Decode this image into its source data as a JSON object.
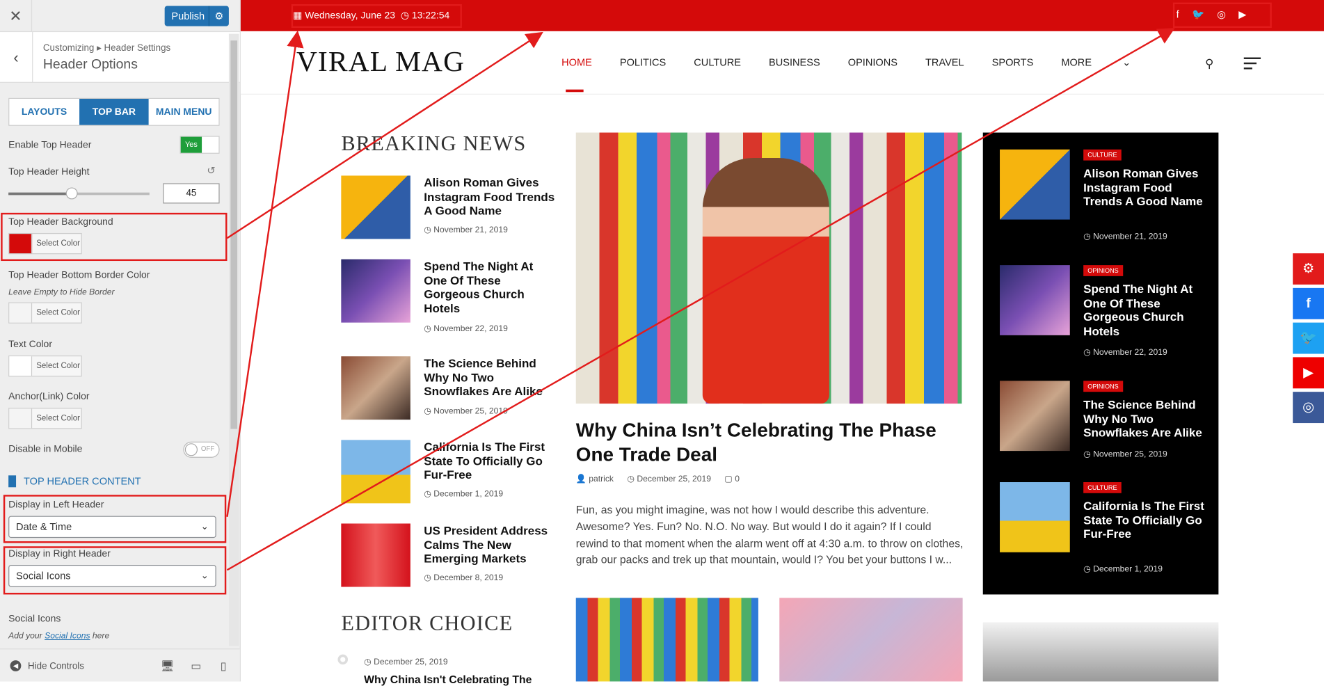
{
  "customizer": {
    "close": "✕",
    "publish": "Publish",
    "breadcrumb": "Customizing ▸ Header Settings",
    "title": "Header Options",
    "tabs": [
      "LAYOUTS",
      "TOP BAR",
      "MAIN MENU"
    ],
    "enable_top_header": "Enable Top Header",
    "toggle_yes": "Yes",
    "top_header_height": "Top Header Height",
    "height_value": "45",
    "height_fraction": 0.45,
    "bg_label": "Top Header Background",
    "bg_color": "#d40a0a",
    "select_color": "Select Color",
    "border_label": "Top Header Bottom Border Color",
    "border_hint": "Leave Empty to Hide Border",
    "text_color": "Text Color",
    "link_color": "Anchor(Link) Color",
    "disable_mobile": "Disable in Mobile",
    "toggle_off": "OFF",
    "section": "TOP HEADER CONTENT",
    "left_label": "Display in Left Header",
    "left_value": "Date & Time",
    "right_label": "Display in Right Header",
    "right_value": "Social Icons",
    "social_label": "Social Icons",
    "social_hint_pre": "Add your ",
    "social_hint_link": "Social Icons",
    "social_hint_post": " here",
    "hide_controls": "Hide Controls"
  },
  "site": {
    "topbar": {
      "date": "Wednesday, June 23",
      "time": "13:22:54"
    },
    "logo": "VIRAL MAG",
    "nav": [
      "HOME",
      "POLITICS",
      "CULTURE",
      "BUSINESS",
      "OPINIONS",
      "TRAVEL",
      "SPORTS",
      "MORE"
    ],
    "breaking_title": "BREAKING NEWS",
    "breaking": [
      {
        "title": "Alison Roman Gives Instagram Food Trends A Good Name",
        "date": "November 21, 2019"
      },
      {
        "title": "Spend The Night At One Of These Gorgeous Church Hotels",
        "date": "November 22, 2019"
      },
      {
        "title": "The Science Behind Why No Two Snowflakes Are Alike",
        "date": "November 25, 2019"
      },
      {
        "title": "California Is The First State To Officially Go Fur-Free",
        "date": "December 1, 2019"
      },
      {
        "title": "US President Address Calms The New Emerging Markets",
        "date": "December 8, 2019"
      }
    ],
    "editor_title": "EDITOR CHOICE",
    "editor_date": "December 25, 2019",
    "editor_partial": "Why China Isn't Celebrating The",
    "hero": {
      "title": "Why China Isn’t Celebrating The Phase One Trade Deal",
      "author": "patrick",
      "date": "December 25, 2019",
      "comments": "0",
      "excerpt": "Fun, as you might imagine, was not how I would describe this adventure. Awesome? Yes. Fun? No. N.O. No way. But would I do it again? If I could rewind to that moment when the alarm went off at 4:30 a.m. to throw on clothes, grab our packs and trek up that mountain, would I? You bet your buttons I w..."
    },
    "dark": [
      {
        "cat": "CULTURE",
        "title": "Alison Roman Gives Instagram Food Trends A Good Name",
        "date": "November 21, 2019"
      },
      {
        "cat": "OPINIONS",
        "title": "Spend The Night At One Of These Gorgeous Church Hotels",
        "date": "November 22, 2019"
      },
      {
        "cat": "OPINIONS",
        "title": "The Science Behind Why No Two Snowflakes Are Alike",
        "date": "November 25, 2019"
      },
      {
        "cat": "CULTURE",
        "title": "California Is The First State To Officially Go Fur-Free",
        "date": "December 1, 2019"
      }
    ]
  },
  "colors": {
    "brand_red": "#d40a0a",
    "wp_blue": "#2271b1",
    "facebook": "#1877f2",
    "twitter": "#1da1f2",
    "youtube": "#e00",
    "instagram": "#3b5998"
  }
}
